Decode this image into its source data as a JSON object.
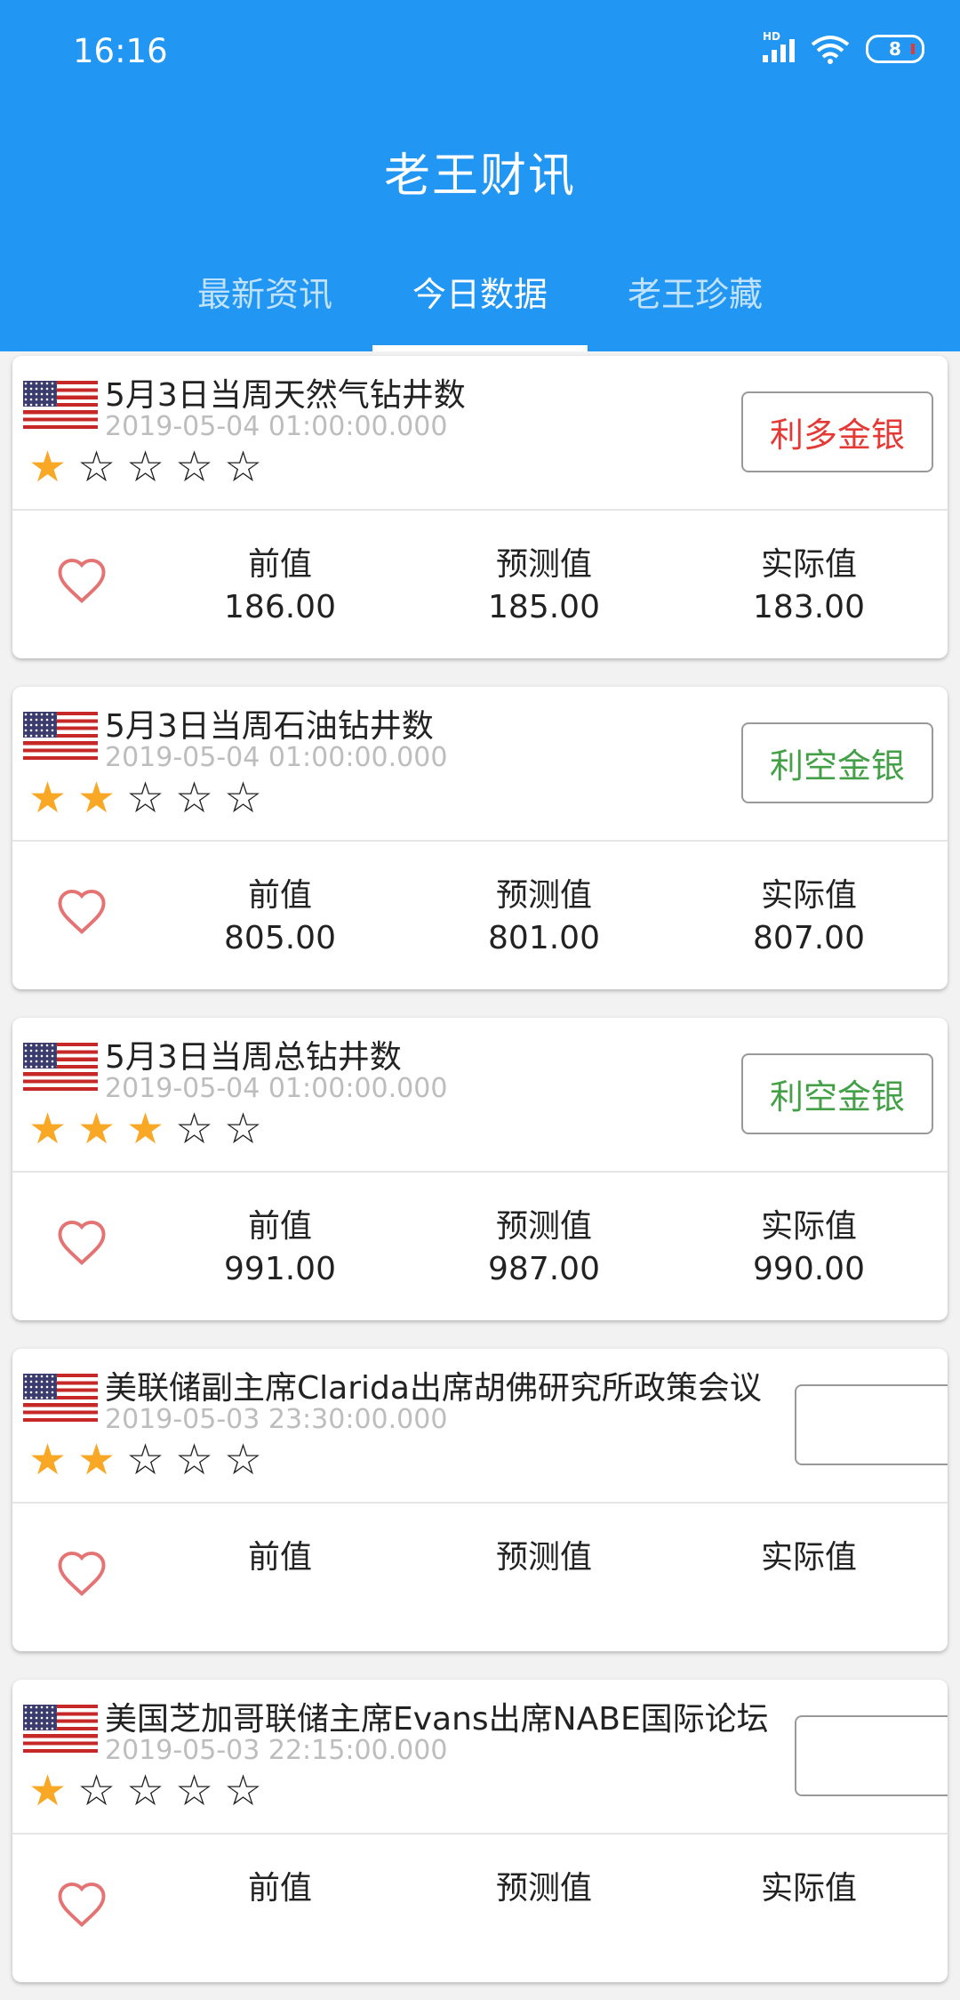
{
  "status_bar": {
    "time": "16:16",
    "battery": "8",
    "signal_tag": "HD"
  },
  "app_title": "老王财讯",
  "tabs": [
    {
      "label": "最新资讯"
    },
    {
      "label": "今日数据",
      "active": true
    },
    {
      "label": "老王珍藏"
    }
  ],
  "colors": {
    "primary": "#2196F3",
    "bullish": "#e53935",
    "bearish": "#43a047",
    "star": "#F9A825",
    "heart": "#e57373"
  },
  "icons": {
    "flag": "us-flag-icon",
    "favorite": "heart-outline-icon",
    "star_filled": "star-filled-icon",
    "star_empty": "star-outline-icon"
  },
  "cards": [
    {
      "title": "5月3日当周天然气钻井数",
      "time": "2019-05-04 01:00:00.000",
      "stars_filled": 1,
      "stars_total": 5,
      "tag": "利多金银",
      "tag_type": "bullish",
      "prev_label": "前值",
      "prev": "186.00",
      "forecast_label": "预测值",
      "forecast": "185.00",
      "actual_label": "实际值",
      "actual": "183.00"
    },
    {
      "title": "5月3日当周石油钻井数",
      "time": "2019-05-04 01:00:00.000",
      "stars_filled": 2,
      "stars_total": 5,
      "tag": "利空金银",
      "tag_type": "bearish",
      "prev_label": "前值",
      "prev": "805.00",
      "forecast_label": "预测值",
      "forecast": "801.00",
      "actual_label": "实际值",
      "actual": "807.00"
    },
    {
      "title": "5月3日当周总钻井数",
      "time": "2019-05-04 01:00:00.000",
      "stars_filled": 3,
      "stars_total": 5,
      "tag": "利空金银",
      "tag_type": "bearish",
      "prev_label": "前值",
      "prev": "991.00",
      "forecast_label": "预测值",
      "forecast": "987.00",
      "actual_label": "实际值",
      "actual": "990.00"
    },
    {
      "title": "美联储副主席Clarida出席胡佛研究所政策会议",
      "time": "2019-05-03 23:30:00.000",
      "stars_filled": 2,
      "stars_total": 5,
      "tag": "",
      "tag_type": "none",
      "prev_label": "前值",
      "prev": "",
      "forecast_label": "预测值",
      "forecast": "",
      "actual_label": "实际值",
      "actual": ""
    },
    {
      "title": "美国芝加哥联储主席Evans出席NABE国际论坛",
      "time": "2019-05-03 22:15:00.000",
      "stars_filled": 1,
      "stars_total": 5,
      "tag": "",
      "tag_type": "none",
      "prev_label": "前值",
      "prev": "",
      "forecast_label": "预测值",
      "forecast": "",
      "actual_label": "实际值",
      "actual": ""
    }
  ]
}
